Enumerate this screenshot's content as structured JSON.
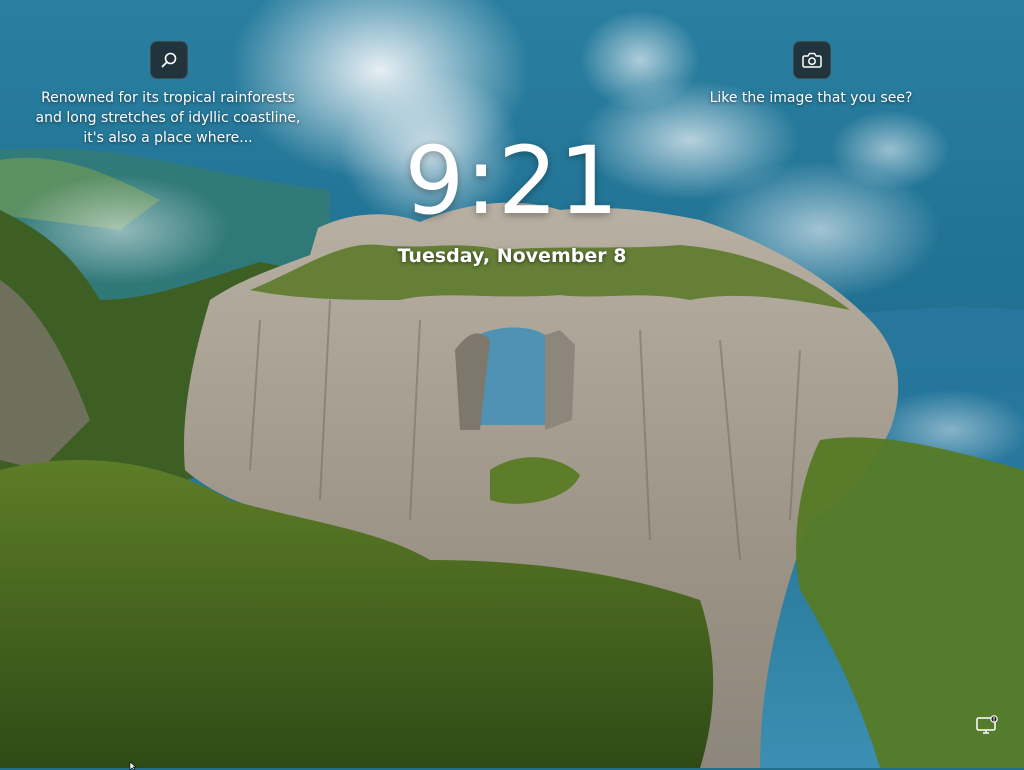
{
  "lockscreen": {
    "time": "9:21",
    "date": "Tuesday, November 8"
  },
  "spotlight": {
    "fact_lines": [
      "Renowned for its tropical rainforests",
      "and long stretches of idyllic coastline,",
      "it's also a place where..."
    ],
    "search_icon": "search-icon",
    "like_text": "Like the image that you see?",
    "camera_icon": "camera-icon"
  },
  "tray": {
    "network_icon": "network-icon"
  },
  "colors": {
    "sky": "#1f6e8c",
    "cloud": "#e8eef2",
    "rock": "#a79e91",
    "vegetation": "#4f6b22",
    "button_bg": "#202020"
  }
}
